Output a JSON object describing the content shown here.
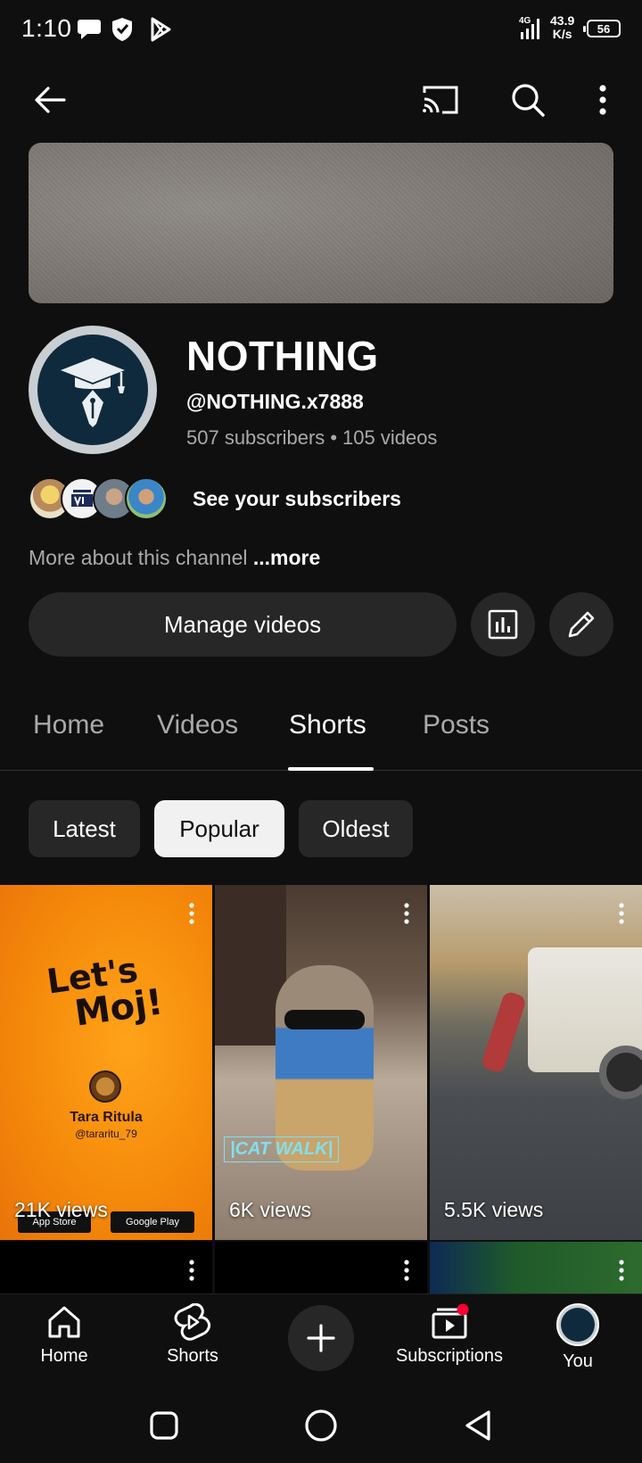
{
  "status_bar": {
    "time": "1:10",
    "network": "4G",
    "speed_value": "43.9",
    "speed_unit": "K/s",
    "battery": "56"
  },
  "app_bar": {
    "icons": [
      "back-arrow-icon",
      "cast-icon",
      "search-icon",
      "more-vert-icon"
    ]
  },
  "channel": {
    "name": "NOTHING",
    "handle": "@NOTHING.x7888",
    "subscribers": "507 subscribers",
    "separator": "•",
    "videos": "105 videos",
    "see_subscribers": "See your subscribers",
    "about_prefix": "More about this channel",
    "about_more": "...more",
    "manage_videos": "Manage videos"
  },
  "tabs": [
    {
      "label": "Home",
      "active": false
    },
    {
      "label": "Videos",
      "active": false
    },
    {
      "label": "Shorts",
      "active": true
    },
    {
      "label": "Posts",
      "active": false
    }
  ],
  "chips": [
    {
      "label": "Latest",
      "selected": false
    },
    {
      "label": "Popular",
      "selected": true
    },
    {
      "label": "Oldest",
      "selected": false
    }
  ],
  "shorts": [
    {
      "views": "21K views",
      "thumb_text_1": "Let's",
      "thumb_text_2": "Moj!",
      "creator": "Tara Ritula",
      "creator_handle": "@tararitu_79",
      "badge_1": "App Store",
      "badge_2": "Google Play"
    },
    {
      "views": "6K views",
      "thumb_text_1": "|CAT WALK|"
    },
    {
      "views": "5.5K views"
    }
  ],
  "bottom_nav": [
    {
      "label": "Home",
      "icon": "home-icon"
    },
    {
      "label": "Shorts",
      "icon": "shorts-icon"
    },
    {
      "label": "",
      "icon": "create-plus-icon"
    },
    {
      "label": "Subscriptions",
      "icon": "subscriptions-icon"
    },
    {
      "label": "You",
      "icon": "account-avatar-icon"
    }
  ],
  "colors": {
    "background": "#0f0f0f",
    "surface": "#272727",
    "muted_text": "#aaaaaa",
    "notification_dot": "#ff0033"
  }
}
